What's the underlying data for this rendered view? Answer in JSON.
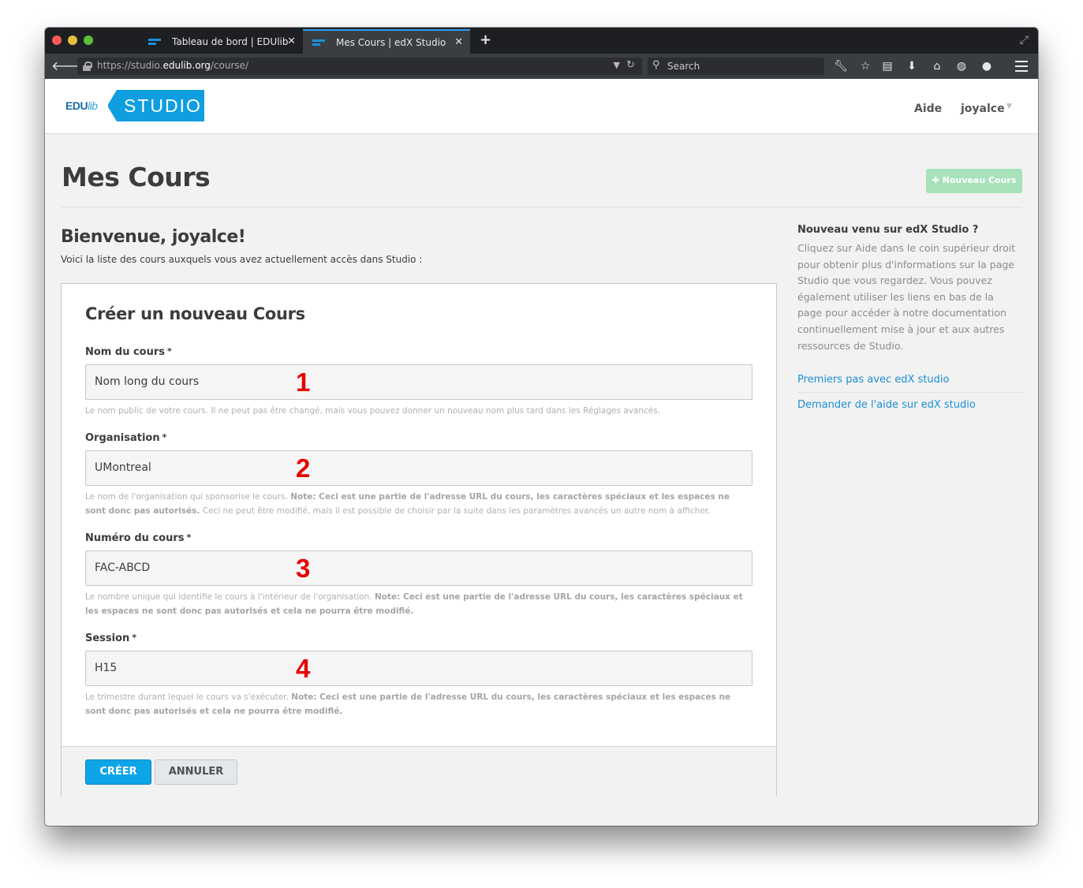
{
  "browser": {
    "tabs": [
      {
        "title": "Tableau de bord | EDUlib",
        "active": false
      },
      {
        "title": "Mes Cours | edX Studio",
        "active": true
      }
    ],
    "new_tab": "+",
    "url_prefix": "https://studio.",
    "url_domain": "edulib.org",
    "url_path": "/course/",
    "search_placeholder": "Search"
  },
  "header": {
    "logo_edu": "EDU",
    "logo_lib": "lib",
    "logo_studio": "STUDIO",
    "help_label": "Aide",
    "user_label": "joyalce"
  },
  "page": {
    "title": "Mes Cours",
    "new_course_button": "Nouveau Cours",
    "welcome": "Bienvenue, joyalce!",
    "intro": "Voici la liste des cours auxquels vous avez actuellement accès dans Studio :"
  },
  "form": {
    "title": "Créer un nouveau Cours",
    "required_mark": "*",
    "fields": [
      {
        "label": "Nom du cours",
        "value": "Nom long du cours",
        "marker": "1",
        "help": "Le nom public de votre cours. Il ne peut pas être changé, mais vous pouvez donner un nouveau nom plus tard dans les Réglages avancés.",
        "help_note": ""
      },
      {
        "label": "Organisation",
        "value": "UMontreal",
        "marker": "2",
        "help": "Le nom de l'organisation qui sponsorise le cours.",
        "help_note": "Note: Ceci est une partie de l'adresse URL du cours, les caractères spéciaux et les espaces ne sont donc pas autorisés.",
        "help_after": "Ceci ne peut être modifié, mais il est possible de choisir par la suite dans les paramètres avancés un autre nom à afficher."
      },
      {
        "label": "Numéro du cours",
        "value": "FAC-ABCD",
        "marker": "3",
        "help": "Le nombre unique qui identifie le cours à l'intérieur de l'organisation.",
        "help_note": "Note: Ceci est une partie de l'adresse URL du cours, les caractères spéciaux et les espaces ne sont donc pas autorisés et cela ne pourra être modifié."
      },
      {
        "label": "Session",
        "value": "H15",
        "marker": "4",
        "help": "Le trimestre durant lequel le cours va s'exécuter.",
        "help_note": "Note: Ceci est une partie de l'adresse URL du cours, les caractères spéciaux et les espaces ne sont donc pas autorisés et cela ne pourra être modifié."
      }
    ],
    "create_button": "CRÉER",
    "cancel_button": "ANNULER"
  },
  "sidebar": {
    "title": "Nouveau venu sur edX Studio ?",
    "text": "Cliquez sur Aide dans le coin supérieur droit pour obtenir plus d'informations sur la page Studio que vous regardez. Vous pouvez également utiliser les liens en bas de la page pour accéder à notre documentation continuellement mise à jour et aux autres ressources de Studio.",
    "links": [
      "Premiers pas avec edX studio",
      "Demander de l'aide sur edX studio"
    ]
  },
  "colors": {
    "accent": "#0ea4e8",
    "new_course_green": "#a8e2ba",
    "marker_red": "#e60000",
    "link": "#1a8fd6"
  }
}
